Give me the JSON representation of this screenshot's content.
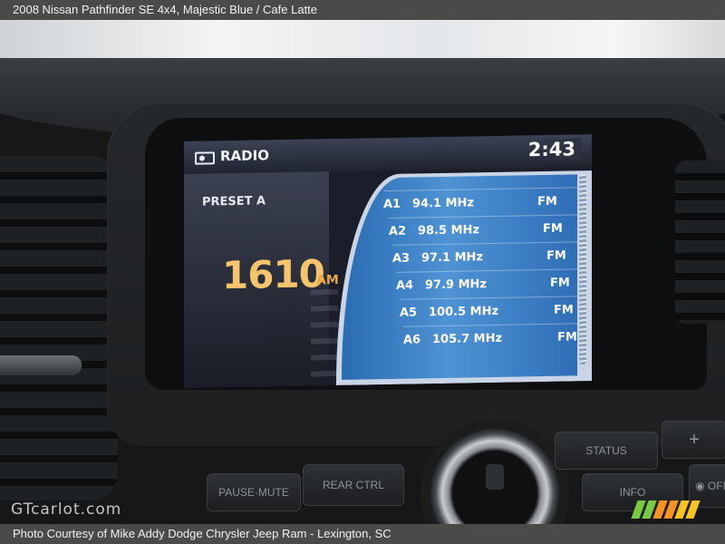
{
  "caption": {
    "title": "2008 Nissan Pathfinder SE 4x4,  Majestic Blue / Cafe Latte",
    "credit": "Photo Courtesy of Mike Addy Dodge Chrysler Jeep Ram - Lexington, SC"
  },
  "screen": {
    "mode_icon": "radio-icon",
    "mode_label": "RADIO",
    "clock": "2:43",
    "preset_label": "PRESET A",
    "frequency": "1610",
    "band": "AM",
    "presets": [
      {
        "id": "A1",
        "freq": "94.1 MHz",
        "band": "FM"
      },
      {
        "id": "A2",
        "freq": "98.5 MHz",
        "band": "FM"
      },
      {
        "id": "A3",
        "freq": "97.1 MHz",
        "band": "FM"
      },
      {
        "id": "A4",
        "freq": "97.9 MHz",
        "band": "FM"
      },
      {
        "id": "A5",
        "freq": "100.5 MHz",
        "band": "FM"
      },
      {
        "id": "A6",
        "freq": "105.7 MHz",
        "band": "FM"
      }
    ]
  },
  "controls": {
    "status": "STATUS",
    "plus": "+",
    "info": "INFO",
    "off": "◉ OFF",
    "pause_mute": "PAUSE·MUTE",
    "rear_ctrl": "REAR CTRL"
  },
  "watermark": "GTcarlot.com",
  "colors": {
    "frequency": "#f6c46a",
    "list_blue": "#3f86cb",
    "logo_green": "#7ac943",
    "logo_orange": "#f7931e"
  }
}
